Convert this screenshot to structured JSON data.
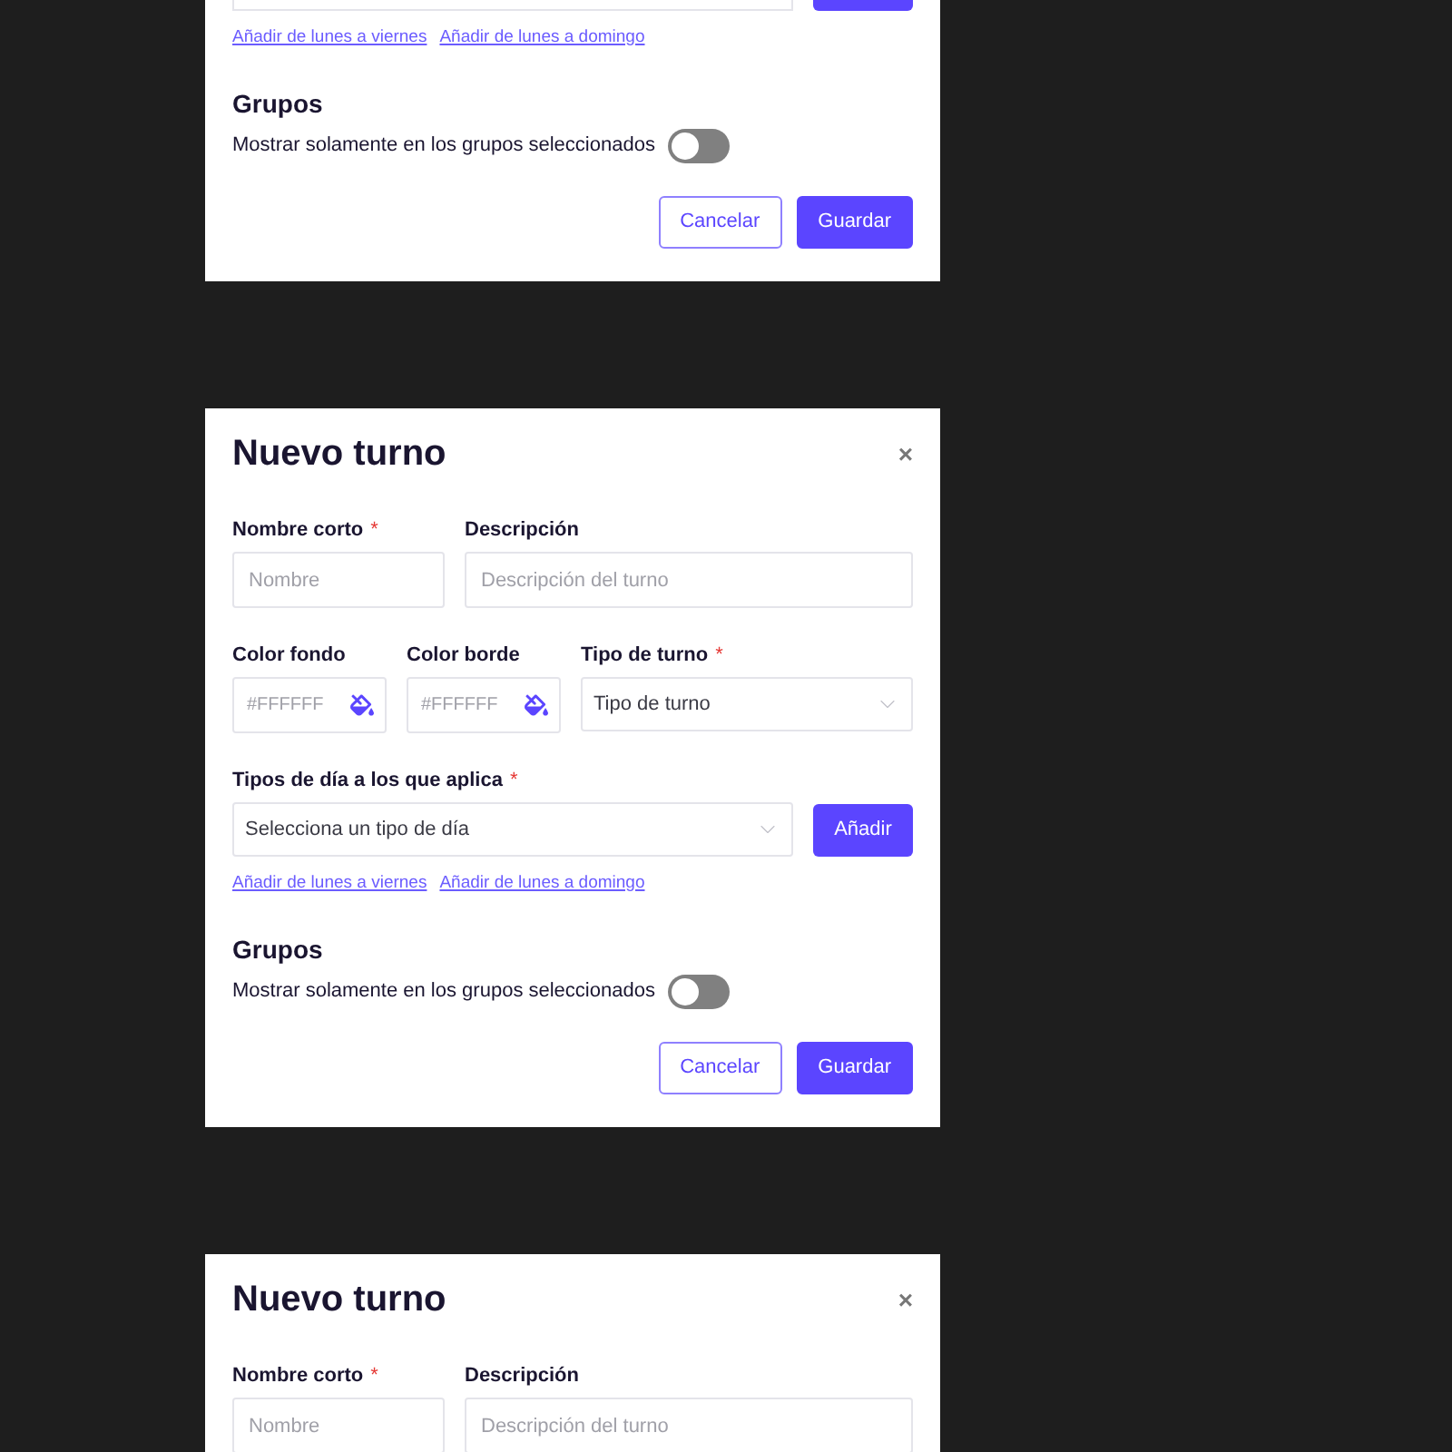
{
  "dialogs": [
    {
      "cut_top": true,
      "links": [
        "Añadir de lunes a viernes",
        "Añadir de lunes a domingo"
      ],
      "groups": {
        "heading": "Grupos",
        "toggle_label": "Mostrar solamente en los grupos seleccionados",
        "on": false
      },
      "buttons": [
        {
          "kind": "secondary",
          "label": "Cancelar"
        },
        {
          "kind": "primary",
          "label": "Guardar"
        }
      ]
    },
    {
      "title": "Nuevo turno",
      "close": "×",
      "name": {
        "label": "Nombre corto",
        "required_mark": "*",
        "placeholder": "Nombre"
      },
      "description": {
        "label": "Descripción",
        "placeholder": "Descripción del turno"
      },
      "color_fields": [
        {
          "label": "Color fondo",
          "placeholder": "#FFFFFF"
        },
        {
          "label": "Color borde",
          "placeholder": "#FFFFFF"
        }
      ],
      "shift_type": {
        "label": "Tipo de turno",
        "required_mark": "*",
        "value": "Tipo de turno"
      },
      "day_types": {
        "label": "Tipos de día a los que aplica",
        "required_mark": "*",
        "value": "Selecciona un tipo de día",
        "button": "Añadir"
      },
      "links": [
        "Añadir de lunes a viernes",
        "Añadir de lunes a domingo"
      ],
      "groups": {
        "heading": "Grupos",
        "toggle_label": "Mostrar solamente en los grupos seleccionados",
        "on": false
      },
      "buttons": [
        {
          "kind": "secondary",
          "label": "Cancelar"
        },
        {
          "kind": "primary",
          "label": "Guardar"
        }
      ]
    },
    {
      "title": "Nuevo turno",
      "close": "×",
      "name": {
        "label": "Nombre corto",
        "required_mark": "*",
        "placeholder": "Nombre"
      },
      "description": {
        "label": "Descripción",
        "placeholder": "Descripción del turno"
      }
    }
  ]
}
